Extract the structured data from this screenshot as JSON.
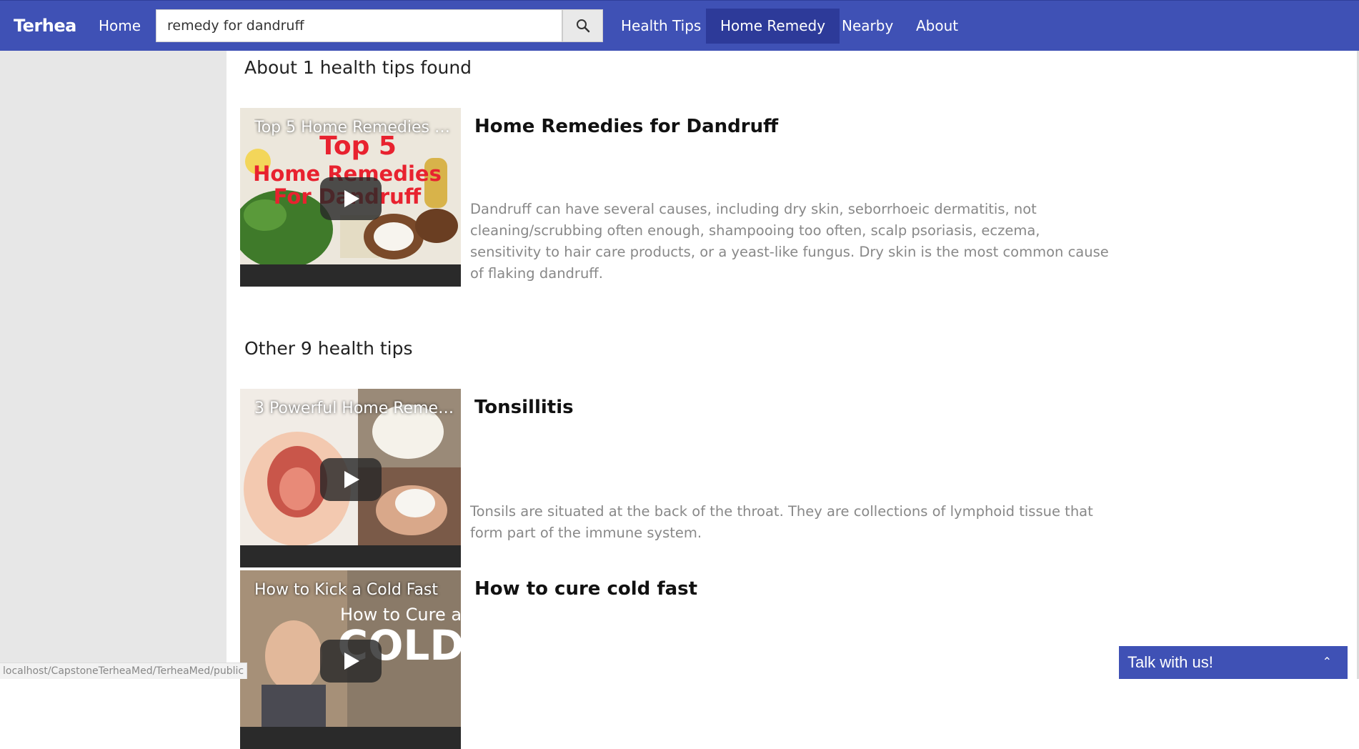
{
  "navbar": {
    "brand": "Terhea",
    "home": "Home",
    "search_value": "remedy for dandruff",
    "links": [
      "Health Tips",
      "Home Remedy",
      "Nearby",
      "About"
    ]
  },
  "results": {
    "heading": "About 1 health tips found",
    "items": [
      {
        "video_title": "Top 5 Home Remedies Fo...",
        "title": "Home Remedies for Dandruff",
        "description": "Dandruff can have several causes, including dry skin, seborrhoeic dermatitis, not cleaning/scrubbing often enough, shampooing too often, scalp psoriasis, eczema, sensitivity to hair care products, or a yeast-like fungus. Dry skin is the most common cause of flaking dandruff."
      }
    ]
  },
  "other": {
    "heading": "Other 9 health tips",
    "items": [
      {
        "video_title": "3 Powerful Home Remedi...",
        "title": "Tonsillitis",
        "description": "Tonsils are situated at the back of the throat. They are collections of lymphoid tissue that form part of the immune system."
      },
      {
        "video_title": "How to Kick a Cold Fast",
        "title": "How to cure cold fast",
        "description": ""
      }
    ]
  },
  "status_url": "localhost/CapstoneTerheaMed/TerheaMed/public",
  "chat": {
    "label": "Talk with us!"
  },
  "icons": {
    "search": "search-icon",
    "play": "play-icon",
    "chevron": "chevron-up-icon"
  },
  "colors": {
    "primary": "#3f51b5",
    "active": "#2d3a99"
  }
}
